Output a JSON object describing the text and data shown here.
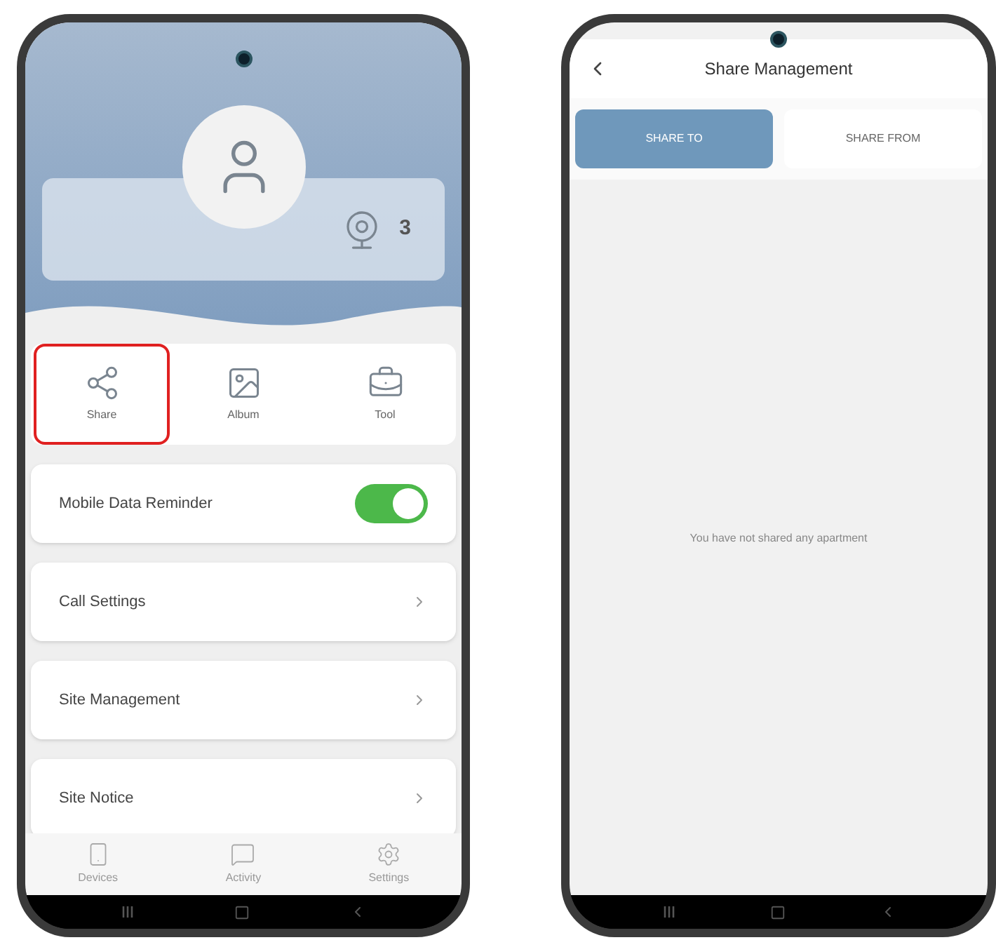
{
  "left_screen": {
    "profile": {
      "device_count": "3"
    },
    "shortcuts": [
      {
        "kind": "share",
        "label": "Share",
        "highlighted": true
      },
      {
        "kind": "album",
        "label": "Album",
        "highlighted": false
      },
      {
        "kind": "tool",
        "label": "Tool",
        "highlighted": false
      }
    ],
    "settings": [
      {
        "kind": "toggle",
        "label": "Mobile Data Reminder",
        "on": true
      },
      {
        "kind": "link",
        "label": "Call Settings"
      },
      {
        "kind": "link",
        "label": "Site Management"
      },
      {
        "kind": "link",
        "label": "Site Notice"
      }
    ],
    "bottom_tabs": [
      {
        "kind": "devices",
        "label": "Devices"
      },
      {
        "kind": "activity",
        "label": "Activity"
      },
      {
        "kind": "settings",
        "label": "Settings"
      }
    ]
  },
  "right_screen": {
    "title": "Share Management",
    "tabs": [
      {
        "label": "SHARE TO",
        "selected": true
      },
      {
        "label": "SHARE FROM",
        "selected": false
      }
    ],
    "empty_message": "You have not shared any apartment"
  }
}
